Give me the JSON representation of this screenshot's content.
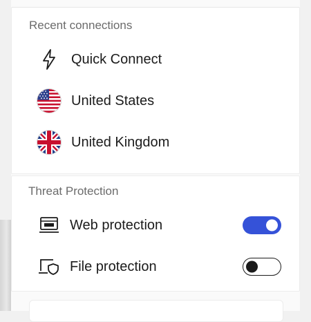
{
  "recent": {
    "title": "Recent connections",
    "items": [
      {
        "label": "Quick Connect",
        "icon": "lightning-icon"
      },
      {
        "label": "United States",
        "icon": "us-flag-icon"
      },
      {
        "label": "United Kingdom",
        "icon": "uk-flag-icon"
      }
    ]
  },
  "threat": {
    "title": "Threat Protection",
    "items": [
      {
        "label": "Web protection",
        "icon": "web-protection-icon",
        "enabled": true
      },
      {
        "label": "File protection",
        "icon": "file-protection-icon",
        "enabled": false
      }
    ]
  },
  "colors": {
    "accent": "#3552d8",
    "text": "#1b1b1b",
    "muted": "#6b6b6b"
  }
}
